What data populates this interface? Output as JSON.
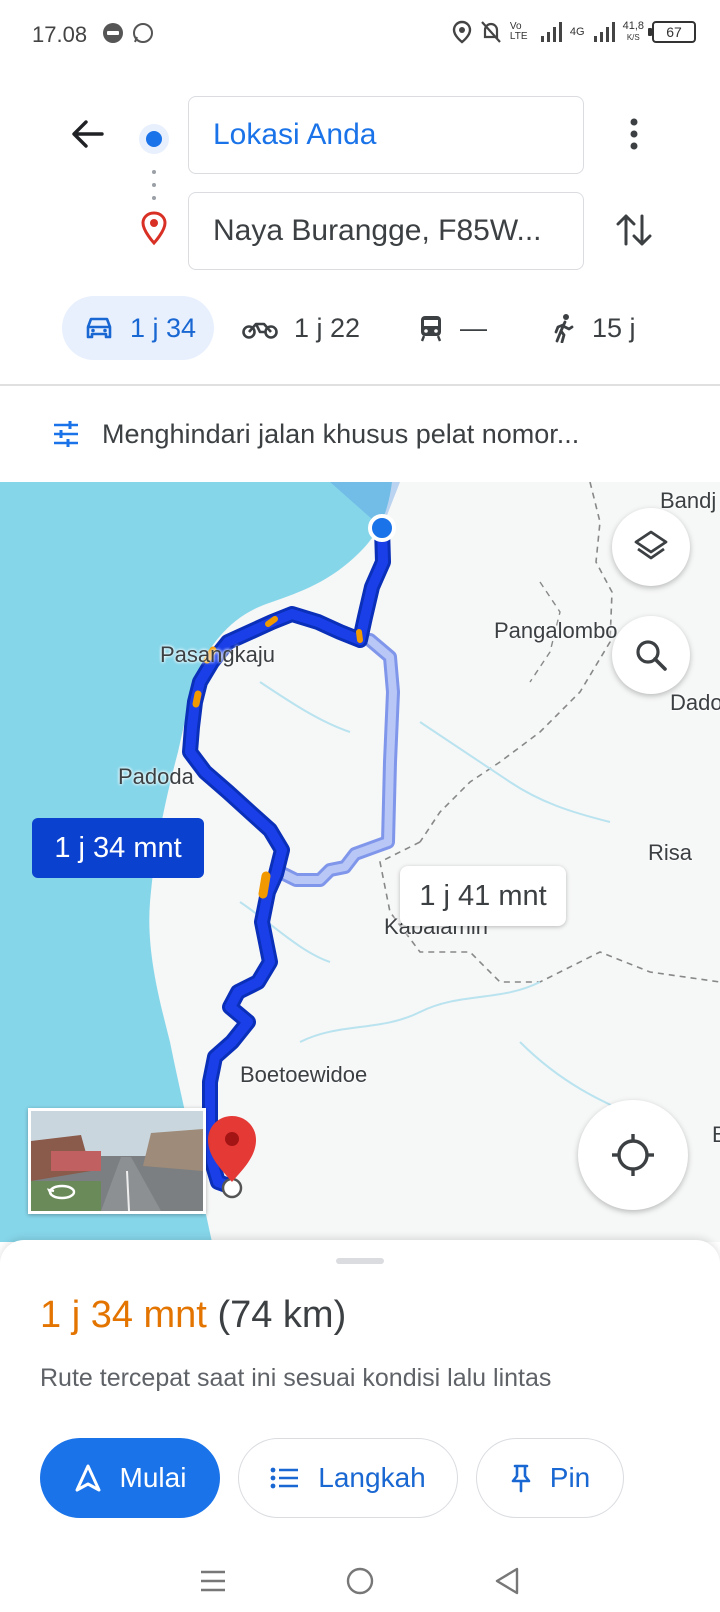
{
  "status_bar": {
    "time": "17.08",
    "battery": "67",
    "net_speed": "41,8",
    "net_unit": "K/S",
    "net_type": "4G",
    "volte": "Vo LTE"
  },
  "directions": {
    "origin": "Lokasi Anda",
    "destination": "Naya Burangge, F85W..."
  },
  "modes": {
    "car": "1 j 34",
    "motorbike": "1 j 22",
    "transit": "—",
    "walk": "15 j"
  },
  "options_text": "Menghindari jalan khusus pelat nomor...",
  "map": {
    "labels": {
      "bandj": "Bandj",
      "pangalombo": "Pangalombo",
      "pasangkaju": "Pasangkaju",
      "dado": "Dado",
      "padoda": "Padoda",
      "risa": "Risa",
      "kabalamin": "Kabalamin",
      "boetoewidoe": "Boetoewidoe",
      "edge_b": "B"
    },
    "route_main_label": "1 j 34 mnt",
    "route_alt_label": "1 j 41 mnt",
    "colors": {
      "water": "#86d6ea",
      "route_main": "#1a3fe8",
      "route_alt": "#a9bdf5",
      "traffic": "#f29900"
    }
  },
  "sheet": {
    "eta_time": "1 j 34 mnt",
    "eta_distance": "(74 km)",
    "description": "Rute tercepat saat ini sesuai kondisi lalu lintas",
    "start_label": "Mulai",
    "steps_label": "Langkah",
    "pin_label": "Pin"
  }
}
